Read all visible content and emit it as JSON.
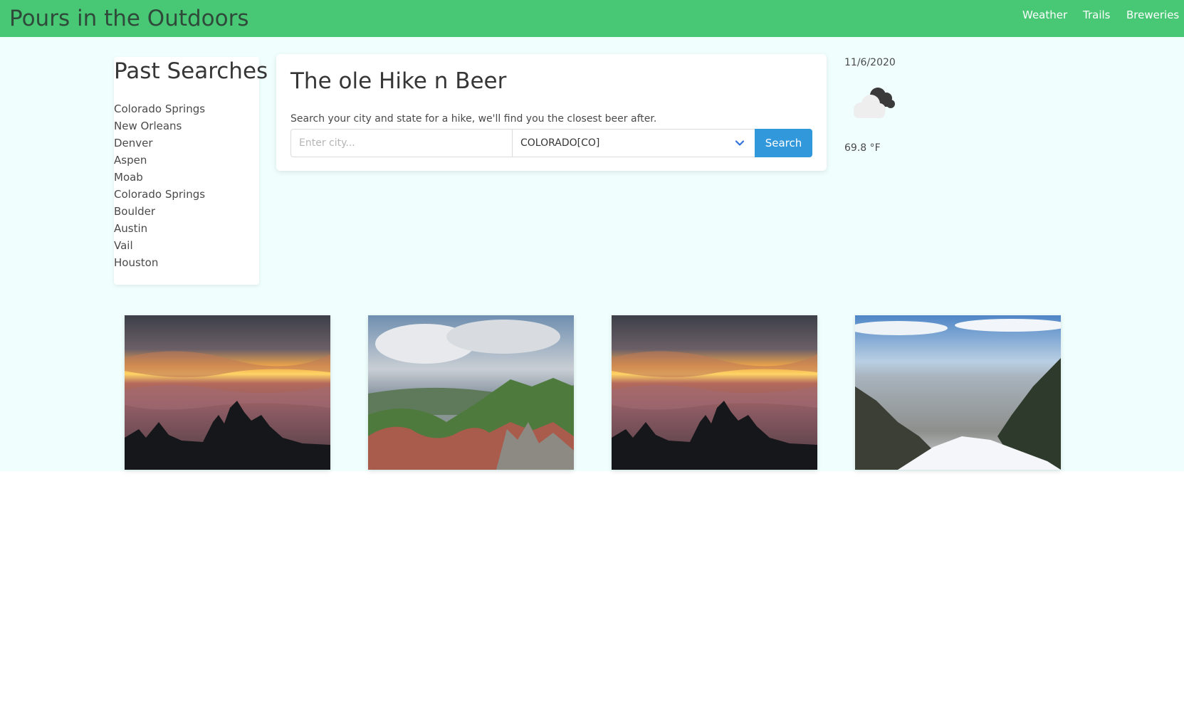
{
  "navbar": {
    "brand": "Pours in the Outdoors",
    "links": [
      "Weather",
      "Trails",
      "Breweries"
    ]
  },
  "past_searches": {
    "title": "Past Searches",
    "items": [
      "Colorado Springs",
      "New Orleans",
      "Denver",
      "Aspen",
      "Moab",
      "Colorado Springs",
      "Boulder",
      "Austin",
      "Vail",
      "Houston"
    ]
  },
  "search": {
    "title": "The ole Hike n Beer",
    "description": "Search your city and state for a hike, we'll find you the closest beer after.",
    "city_placeholder": "Enter city...",
    "city_value": "",
    "state_value": "COLORADO[CO]",
    "button_label": "Search"
  },
  "weather": {
    "date": "11/6/2020",
    "icon": "cloudy-icon",
    "temperature": "69.8 °F"
  },
  "trails": [
    {
      "image": "sunset-cloud-sea"
    },
    {
      "image": "rocky-mountain-ridge"
    },
    {
      "image": "sunset-cloud-sea"
    },
    {
      "image": "snowy-city-overlook"
    }
  ],
  "colors": {
    "navbar": "#48c774",
    "page_background": "#f0fffe",
    "button": "#3298dc"
  }
}
